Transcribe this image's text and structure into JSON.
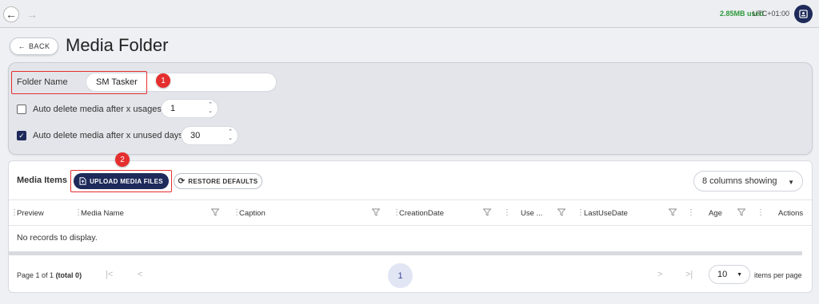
{
  "topbar": {
    "usage": "2.85MB used",
    "timezone": "UTC+01:00"
  },
  "header": {
    "back_label": "BACK",
    "title": "Media Folder"
  },
  "folder": {
    "name_label": "Folder Name",
    "name_value": "SM Tasker"
  },
  "auto_delete_usages": {
    "label": "Auto delete media after x usages",
    "value": "1",
    "checked": false
  },
  "auto_delete_days": {
    "label": "Auto delete media after x unused days",
    "value": "30",
    "checked": true
  },
  "badges": [
    "1",
    "2"
  ],
  "media": {
    "title": "Media Items",
    "upload_label": "UPLOAD MEDIA FILES",
    "restore_label": "RESTORE DEFAULTS",
    "columns_label": "8 columns showing",
    "columns": [
      "Preview",
      "Media Name",
      "Caption",
      "CreationDate",
      "Use ...",
      "LastUseDate",
      "Age",
      "Actions"
    ],
    "empty_text": "No records to display."
  },
  "pagination": {
    "page_text": "Page 1 of 1",
    "total_text": "(total 0)",
    "current_page": "1",
    "per_page": "10",
    "per_page_label": "items per page"
  },
  "colors": {
    "accent": "#1e2a5a",
    "highlight": "#e52e2e",
    "usage": "#2e9a3c"
  }
}
